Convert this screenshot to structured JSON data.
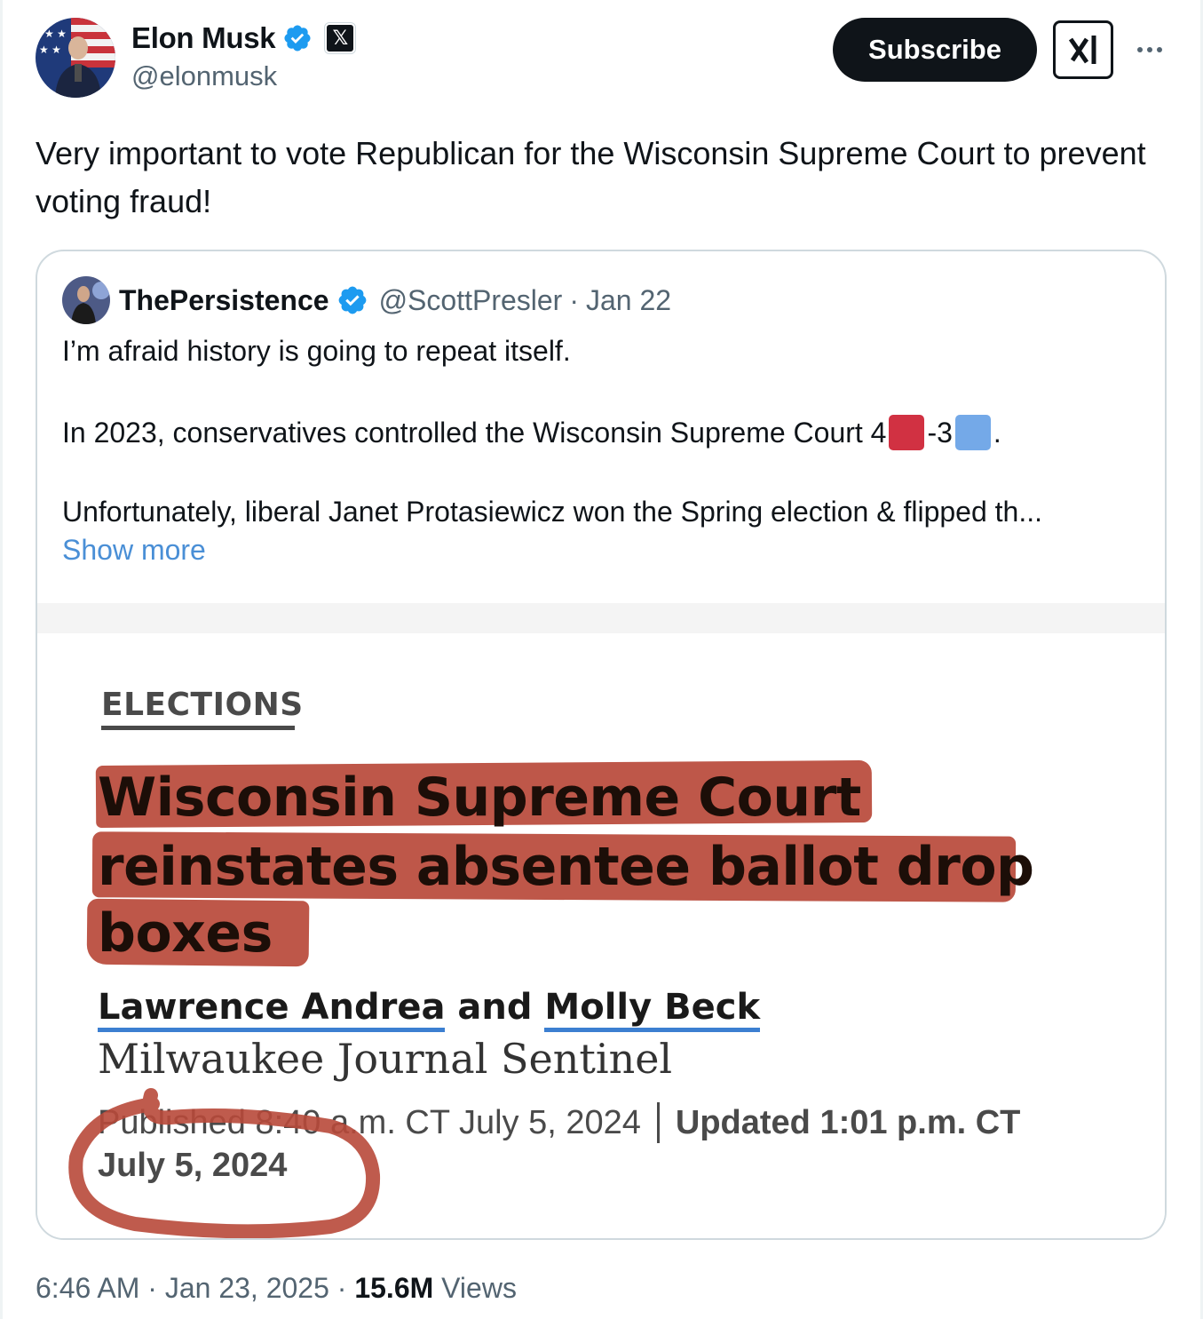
{
  "author": {
    "name": "Elon Musk",
    "handle": "@elonmusk",
    "affiliate_badge": "𝕏"
  },
  "actions": {
    "subscribe_label": "Subscribe",
    "grok_icon": "grok-icon",
    "more_icon": "more-icon"
  },
  "tweet": {
    "text": "Very important to vote Republican for the Wisconsin Supreme Court to prevent voting fraud!"
  },
  "quoted": {
    "name": "ThePersistence",
    "handle": "@ScottPresler",
    "separator": "·",
    "date": "Jan 22",
    "line1": "I’m afraid history is going to repeat itself.",
    "line2_prefix": "In 2023, conservatives controlled the Wisconsin Supreme Court 4",
    "line2_mid": "-3",
    "line2_suffix": ".",
    "line3": "Unfortunately, liberal Janet Protasiewicz won the Spring election & flipped th...",
    "show_more": "Show more",
    "colors": {
      "red_square": "#d13142",
      "blue_square": "#74a9e8"
    }
  },
  "article": {
    "section": "ELECTIONS",
    "headline_lines": [
      "Wisconsin Supreme Court",
      "reinstates absentee ballot drop",
      "boxes"
    ],
    "author1": "Lawrence Andrea",
    "and": " and ",
    "author2": "Molly Beck",
    "publisher": "Milwaukee Journal Sentinel",
    "published": "Published 8:40 a.m. CT July 5, 2024",
    "updated": "Updated 1:01 p.m. CT",
    "updated_date": "July 5, 2024",
    "highlight_color": "#b8493a"
  },
  "footer": {
    "time": "6:46 AM",
    "sep": " · ",
    "date": "Jan 23, 2025",
    "views_count": "15.6M",
    "views_label": " Views"
  }
}
